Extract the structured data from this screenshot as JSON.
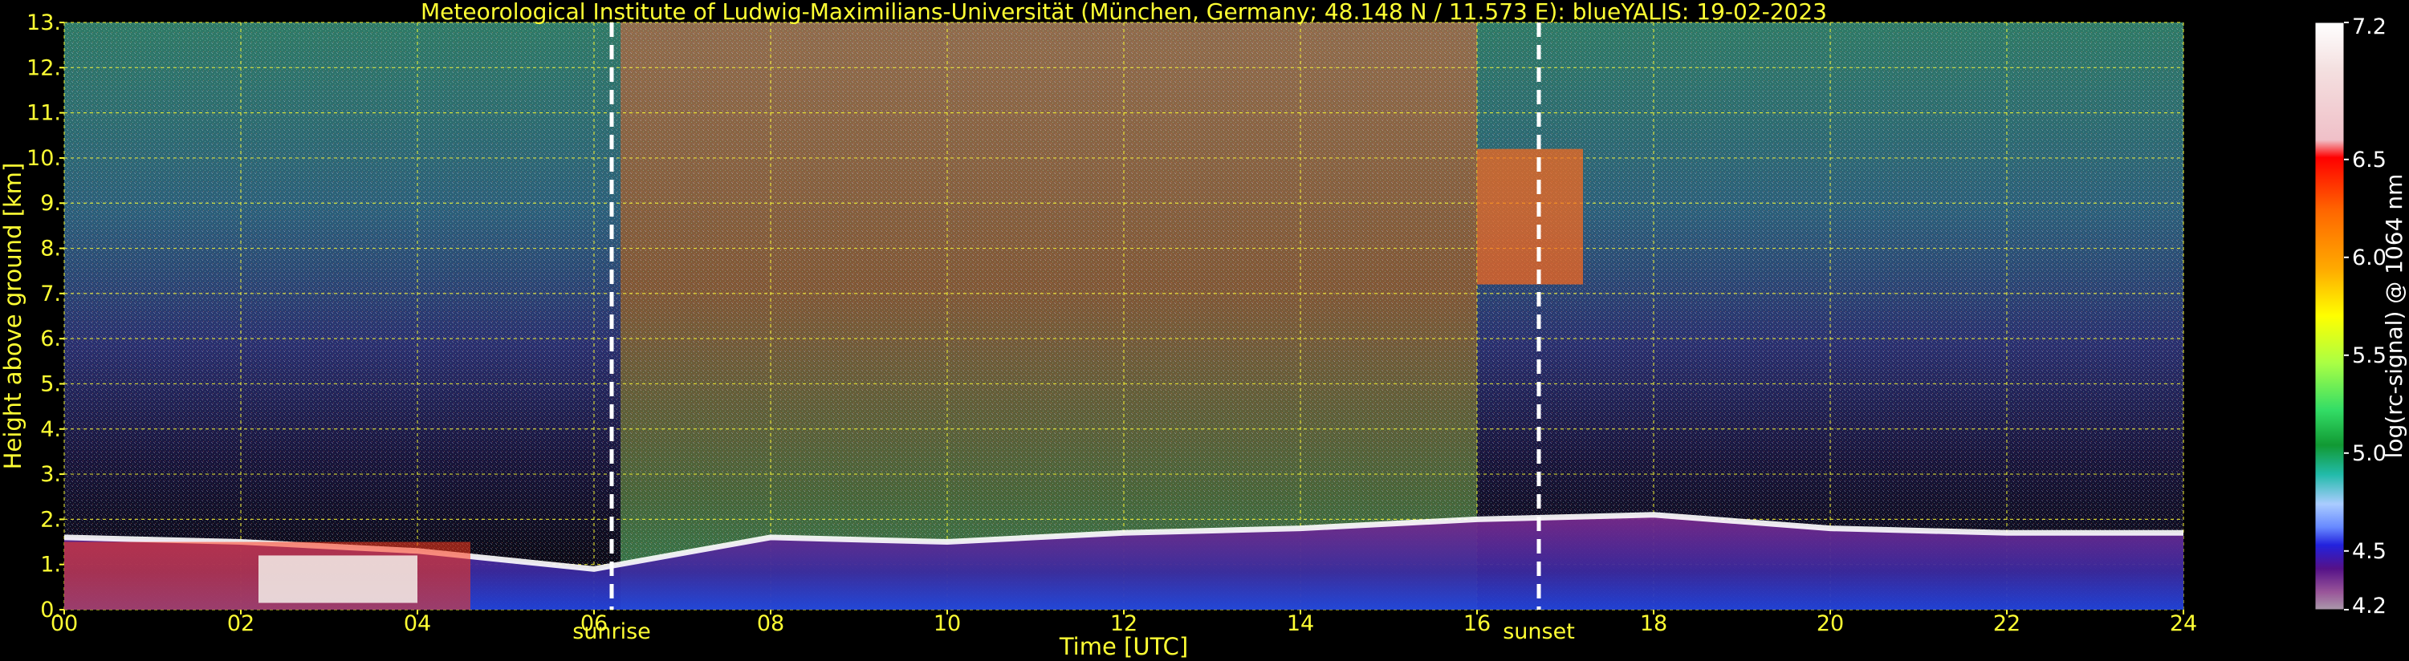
{
  "chart_data": {
    "type": "heatmap",
    "title": "Meteorological Institute of Ludwig-Maximilians-Universität (München, Germany; 48.148 N / 11.573 E):     blueYALIS: 19-02-2023",
    "xlabel": "Time [UTC]",
    "ylabel": "Height above ground [km]",
    "xlim": [
      0,
      24
    ],
    "ylim": [
      0,
      13
    ],
    "x_ticks": [
      "00",
      "02",
      "04",
      "06",
      "08",
      "10",
      "12",
      "14",
      "16",
      "18",
      "20",
      "22",
      "24"
    ],
    "y_ticks": [
      "0.",
      "1.",
      "2.",
      "3.",
      "4.",
      "5.",
      "6.",
      "7.",
      "8.",
      "9.",
      "10.",
      "11.",
      "12.",
      "13."
    ],
    "grid": true,
    "markers": [
      {
        "label": "sunrise",
        "time": 6.2
      },
      {
        "label": "sunset",
        "time": 16.7
      }
    ],
    "colorbar": {
      "label": "log(rc-signal) @ 1064 nm",
      "range": [
        4.2,
        7.2
      ],
      "ticks": [
        "7.2",
        "6.5",
        "6.0",
        "5.5",
        "5.0",
        "4.5",
        "4.2"
      ],
      "tick_values": [
        7.2,
        6.5,
        6.0,
        5.5,
        5.0,
        4.5,
        4.2
      ]
    },
    "features": [
      {
        "kind": "boundary_layer_top_km",
        "times": [
          0,
          2,
          4,
          6,
          8,
          10,
          12,
          14,
          16,
          18,
          20,
          22,
          24
        ],
        "heights": [
          1.6,
          1.5,
          1.3,
          0.9,
          1.6,
          1.5,
          1.7,
          1.8,
          2.0,
          2.1,
          1.8,
          1.7,
          1.7
        ]
      },
      {
        "kind": "cirrus_cloud",
        "time_range": [
          16.0,
          17.2
        ],
        "height_range": [
          7.2,
          10.2
        ]
      }
    ]
  },
  "colors": {
    "text": "#ffff33",
    "grid": "#ffff33",
    "colorbar_stops": [
      "#ffffff",
      "#f0d0d0",
      "#ff0000",
      "#ff6600",
      "#ffaa00",
      "#ffff00",
      "#aaff44",
      "#33dd66",
      "#119933",
      "#22bbaa",
      "#aaccff",
      "#6688ff",
      "#2222dd",
      "#551188",
      "#883399",
      "#aa88aa"
    ]
  }
}
